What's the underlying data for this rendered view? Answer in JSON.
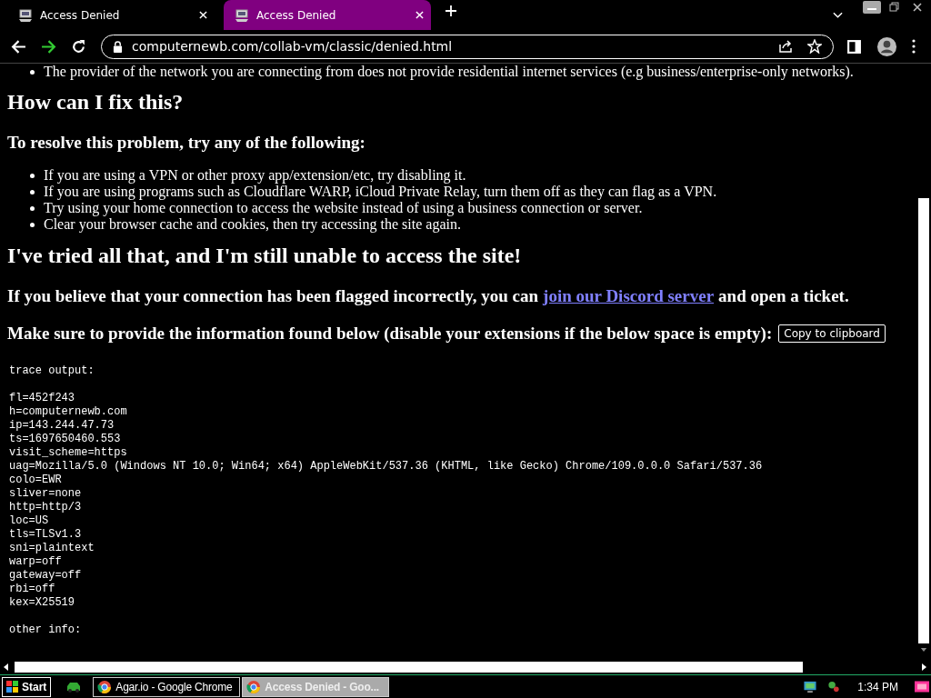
{
  "tabs": [
    {
      "title": "Access Denied",
      "selected": false
    },
    {
      "title": "Access Denied",
      "selected": true
    }
  ],
  "address_bar": {
    "url": "computernewb.com/collab-vm/classic/denied.html"
  },
  "page": {
    "partial_item": "The provider of the network you are connecting from does not provide residential internet services (e.g business/enterprise-only networks).",
    "fix_heading": "How can I fix this?",
    "resolve_heading": "To resolve this problem, try any of the following:",
    "steps": [
      "If you are using a VPN or other proxy app/extension/etc, try disabling it.",
      "If you are using programs such as Cloudflare WARP, iCloud Private Relay, turn them off as they can flag as a VPN.",
      "Try using your home connection to access the website instead of using a business connection or server.",
      "Clear your browser cache and cookies, then try accessing the site again."
    ],
    "tried_heading": "I've tried all that, and I'm still unable to access the site!",
    "discord_before": "If you believe that your connection has been flagged incorrectly, you can",
    "discord_link": "join our Discord server",
    "discord_after": "and open a ticket.",
    "info_prompt": "Make sure to provide the information found below (disable your extensions if the below space is empty):",
    "copy_button": "Copy to clipboard",
    "trace_title": "trace output:",
    "trace_lines": [
      "fl=452f243",
      "h=computernewb.com",
      "ip=143.244.47.73",
      "ts=1697650460.553",
      "visit_scheme=https",
      "uag=Mozilla/5.0 (Windows NT 10.0; Win64; x64) AppleWebKit/537.36 (KHTML, like Gecko) Chrome/109.0.0.0 Safari/537.36",
      "colo=EWR",
      "sliver=none",
      "http=http/3",
      "loc=US",
      "tls=TLSv1.3",
      "sni=plaintext",
      "warp=off",
      "gateway=off",
      "rbi=off",
      "kex=X25519"
    ],
    "other_info": "other info:"
  },
  "taskbar": {
    "start": "Start",
    "windows": [
      {
        "title": "Agar.io - Google Chrome",
        "selected": false
      },
      {
        "title": "Access Denied - Goo...",
        "selected": true
      }
    ],
    "clock": "1:34 PM"
  }
}
